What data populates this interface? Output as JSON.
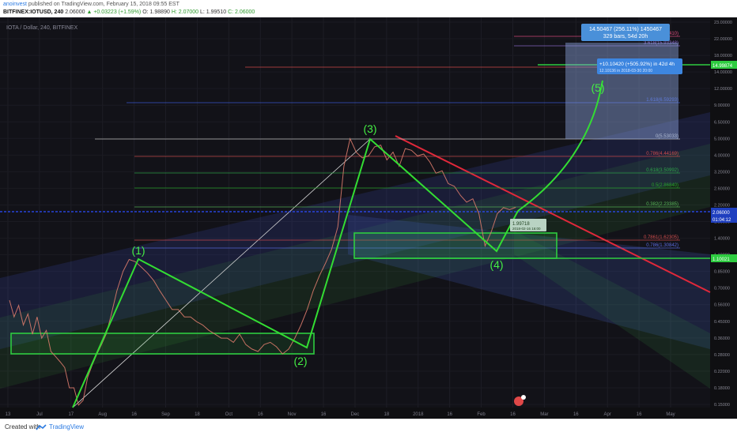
{
  "header": {
    "author": "anoinvest",
    "published": "published on TradingView.com, February 15, 2018 09:55 EST",
    "symbol": "BITFINEX:IOTUSD, 240",
    "last": "2.06000",
    "change": "▲ +0.03223 (+1.59%)",
    "open": "O: 1.98890",
    "high": "H: 2.07000",
    "low": "L: 1.99510",
    "close": "C: 2.06000"
  },
  "chart_data": {
    "type": "line",
    "title": "IOTA / Dollar, 240, BITFINEX",
    "price_scale": "log",
    "ylim": [
      0.155,
      23.0
    ],
    "x_tick_labels": [
      "13",
      "Jul",
      "17",
      "Aug",
      "16",
      "Sep",
      "18",
      "Oct",
      "16",
      "Nov",
      "16",
      "Dec",
      "18",
      "2018",
      "16",
      "Feb",
      "16",
      "Mar",
      "16",
      "Apr",
      "16",
      "May"
    ],
    "y_tick_labels": [
      "23.00000",
      "22.00000",
      "18.00000",
      "14.00000",
      "12.00000",
      "9.00000",
      "6.50000",
      "5.00000",
      "4.00000",
      "3.20000",
      "2.60000",
      "2.20000",
      "1.80000",
      "1.40000",
      "1.10000",
      "0.85000",
      "0.70000",
      "0.56000",
      "0.45000",
      "0.36000",
      "0.28000",
      "0.22000",
      "0.18000",
      "0.15000"
    ],
    "series": [
      {
        "name": "IOTUSD",
        "x": [
          0,
          6,
          12,
          18,
          24,
          30,
          36,
          42,
          48,
          54,
          60,
          66,
          72,
          78,
          84,
          90,
          96,
          102,
          108,
          114,
          120,
          126,
          132,
          140,
          148,
          156,
          164,
          172,
          180,
          188,
          196,
          204,
          212,
          220,
          228,
          236,
          244,
          252,
          260,
          268,
          276,
          284,
          292,
          300,
          308,
          316,
          324,
          332,
          340,
          348,
          356,
          364,
          372,
          380,
          388,
          396,
          404,
          412,
          420,
          428,
          436,
          444,
          452,
          460,
          468,
          476,
          484,
          492,
          500,
          508,
          516,
          524,
          532,
          540,
          548,
          556,
          564,
          572,
          580,
          588,
          596,
          604,
          612,
          620,
          628,
          636,
          644,
          652,
          660
        ],
        "y": [
          0.62,
          0.5,
          0.58,
          0.45,
          0.52,
          0.4,
          0.5,
          0.38,
          0.42,
          0.32,
          0.3,
          0.28,
          0.26,
          0.2,
          0.2,
          0.16,
          0.17,
          0.23,
          0.27,
          0.31,
          0.35,
          0.4,
          0.5,
          0.7,
          0.9,
          1.05,
          1.02,
          0.95,
          0.88,
          0.8,
          0.7,
          0.62,
          0.55,
          0.55,
          0.5,
          0.5,
          0.47,
          0.45,
          0.42,
          0.4,
          0.38,
          0.38,
          0.36,
          0.4,
          0.35,
          0.33,
          0.32,
          0.35,
          0.36,
          0.34,
          0.31,
          0.33,
          0.38,
          0.45,
          0.55,
          0.7,
          0.85,
          1.0,
          1.2,
          1.6,
          3.5,
          5.0,
          4.2,
          3.9,
          4.0,
          4.5,
          4.6,
          3.8,
          4.2,
          3.5,
          4.4,
          4.3,
          4.0,
          4.1,
          3.7,
          3.2,
          3.3,
          2.8,
          2.7,
          2.4,
          2.2,
          2.3,
          1.9,
          1.25,
          1.5,
          1.9,
          2.05,
          2.0,
          2.06
        ]
      }
    ],
    "wave_labels": [
      "(1)",
      "(2)",
      "(3)",
      "(4)",
      "(5)"
    ],
    "fib_levels": [
      {
        "label": "4.236(23.31410)",
        "color": "#e05080"
      },
      {
        "label": "3.618(15.93348)",
        "color": "#8e6bd1"
      },
      {
        "label": "2.618(6.66721)",
        "color": "#e05050"
      },
      {
        "label": "1.618(6.59293)",
        "color": "#3b5bdb"
      },
      {
        "label": "0(5.53033)",
        "color": "#cccccc"
      },
      {
        "label": "0.786(4.44169)",
        "color": "#d04d4d"
      },
      {
        "label": "0.618(3.50992)",
        "color": "#2ea84a"
      },
      {
        "label": "0.5(2.86840)",
        "color": "#27a827"
      },
      {
        "label": "0.382(2.23385)",
        "color": "#59b859"
      },
      {
        "label": "0.7861(1.62305)",
        "color": "#d04d4d"
      },
      {
        "label": "0.786(1.30842)",
        "color": "#5a6be0"
      }
    ],
    "measure_box": {
      "line1": "14.50467 (256.11%) 1450467",
      "line2": "329 bars, 54d 20h"
    },
    "projection_label": {
      "line1": "+10.10420 (+505.92%) in 42d 4h",
      "line2": "12.10136 in 2018-03-30 20:00"
    },
    "point_label": {
      "line1": "1.99718",
      "line2": "2018-02-16 16:00"
    },
    "price_tags": [
      {
        "text": "14.99874",
        "color": "#2ecc40"
      },
      {
        "text": "2.06000",
        "color": "#1f3fbf"
      },
      {
        "text": "01:04:12",
        "color": "#1f3fbf"
      },
      {
        "text": "1.10021",
        "color": "#2ecc40"
      }
    ]
  },
  "footer": {
    "created_with": "Created with",
    "brand": "TradingView"
  }
}
